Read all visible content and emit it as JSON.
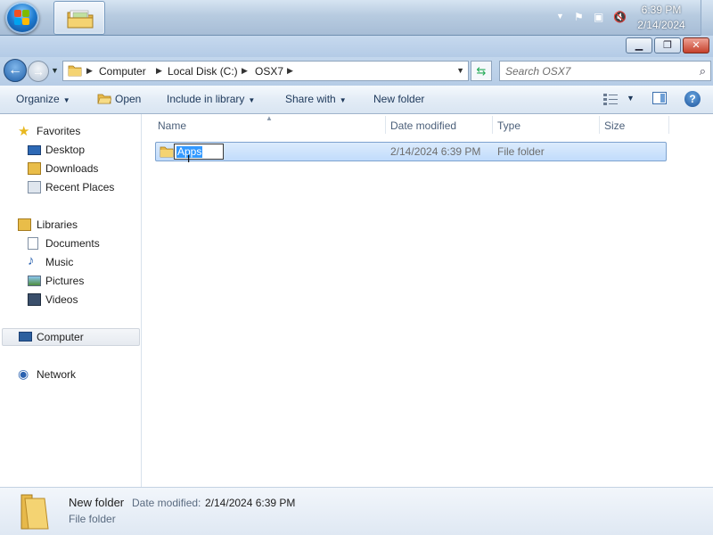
{
  "taskbar": {
    "clock_time": "6:39 PM",
    "clock_date": "2/14/2024"
  },
  "address": {
    "crumbs": [
      "Computer",
      "Local Disk (C:)",
      "OSX7"
    ],
    "search_placeholder": "Search OSX7"
  },
  "toolbar": {
    "organize": "Organize",
    "open": "Open",
    "include_in_library": "Include in library",
    "share_with": "Share with",
    "new_folder": "New folder"
  },
  "nav": {
    "favorites": "Favorites",
    "desktop": "Desktop",
    "downloads": "Downloads",
    "recent_places": "Recent Places",
    "libraries": "Libraries",
    "documents": "Documents",
    "music": "Music",
    "pictures": "Pictures",
    "videos": "Videos",
    "computer": "Computer",
    "network": "Network"
  },
  "columns": {
    "name": "Name",
    "date_modified": "Date modified",
    "type": "Type",
    "size": "Size"
  },
  "file_row": {
    "name_editing": "Apps",
    "date_modified": "2/14/2024 6:39 PM",
    "type": "File folder",
    "size": ""
  },
  "details": {
    "name": "New folder",
    "modified_label": "Date modified:",
    "modified_value": "2/14/2024 6:39 PM",
    "type": "File folder"
  },
  "colors": {
    "accent": "#3399ff",
    "selection_fill": "#cce4fc",
    "selection_border": "#7da2ce",
    "folder_yellow": "#f0c94d"
  }
}
